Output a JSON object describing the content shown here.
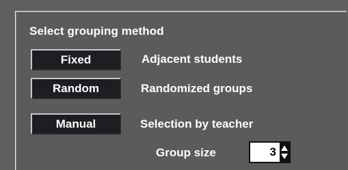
{
  "grouping": {
    "heading": "Select grouping method",
    "methods": [
      {
        "button_label": "Fixed",
        "description": "Adjacent students"
      },
      {
        "button_label": "Random",
        "description": "Randomized groups"
      },
      {
        "button_label": "Manual",
        "description": "Selection by teacher"
      }
    ],
    "group_size": {
      "label": "Group size",
      "value": "3"
    }
  },
  "icons": {
    "stepper_up": "arrow-up-icon",
    "stepper_down": "arrow-down-icon"
  },
  "colors": {
    "panel_background": "#5b5b5b",
    "button_background": "#1d1e22",
    "text": "#ffffff"
  }
}
